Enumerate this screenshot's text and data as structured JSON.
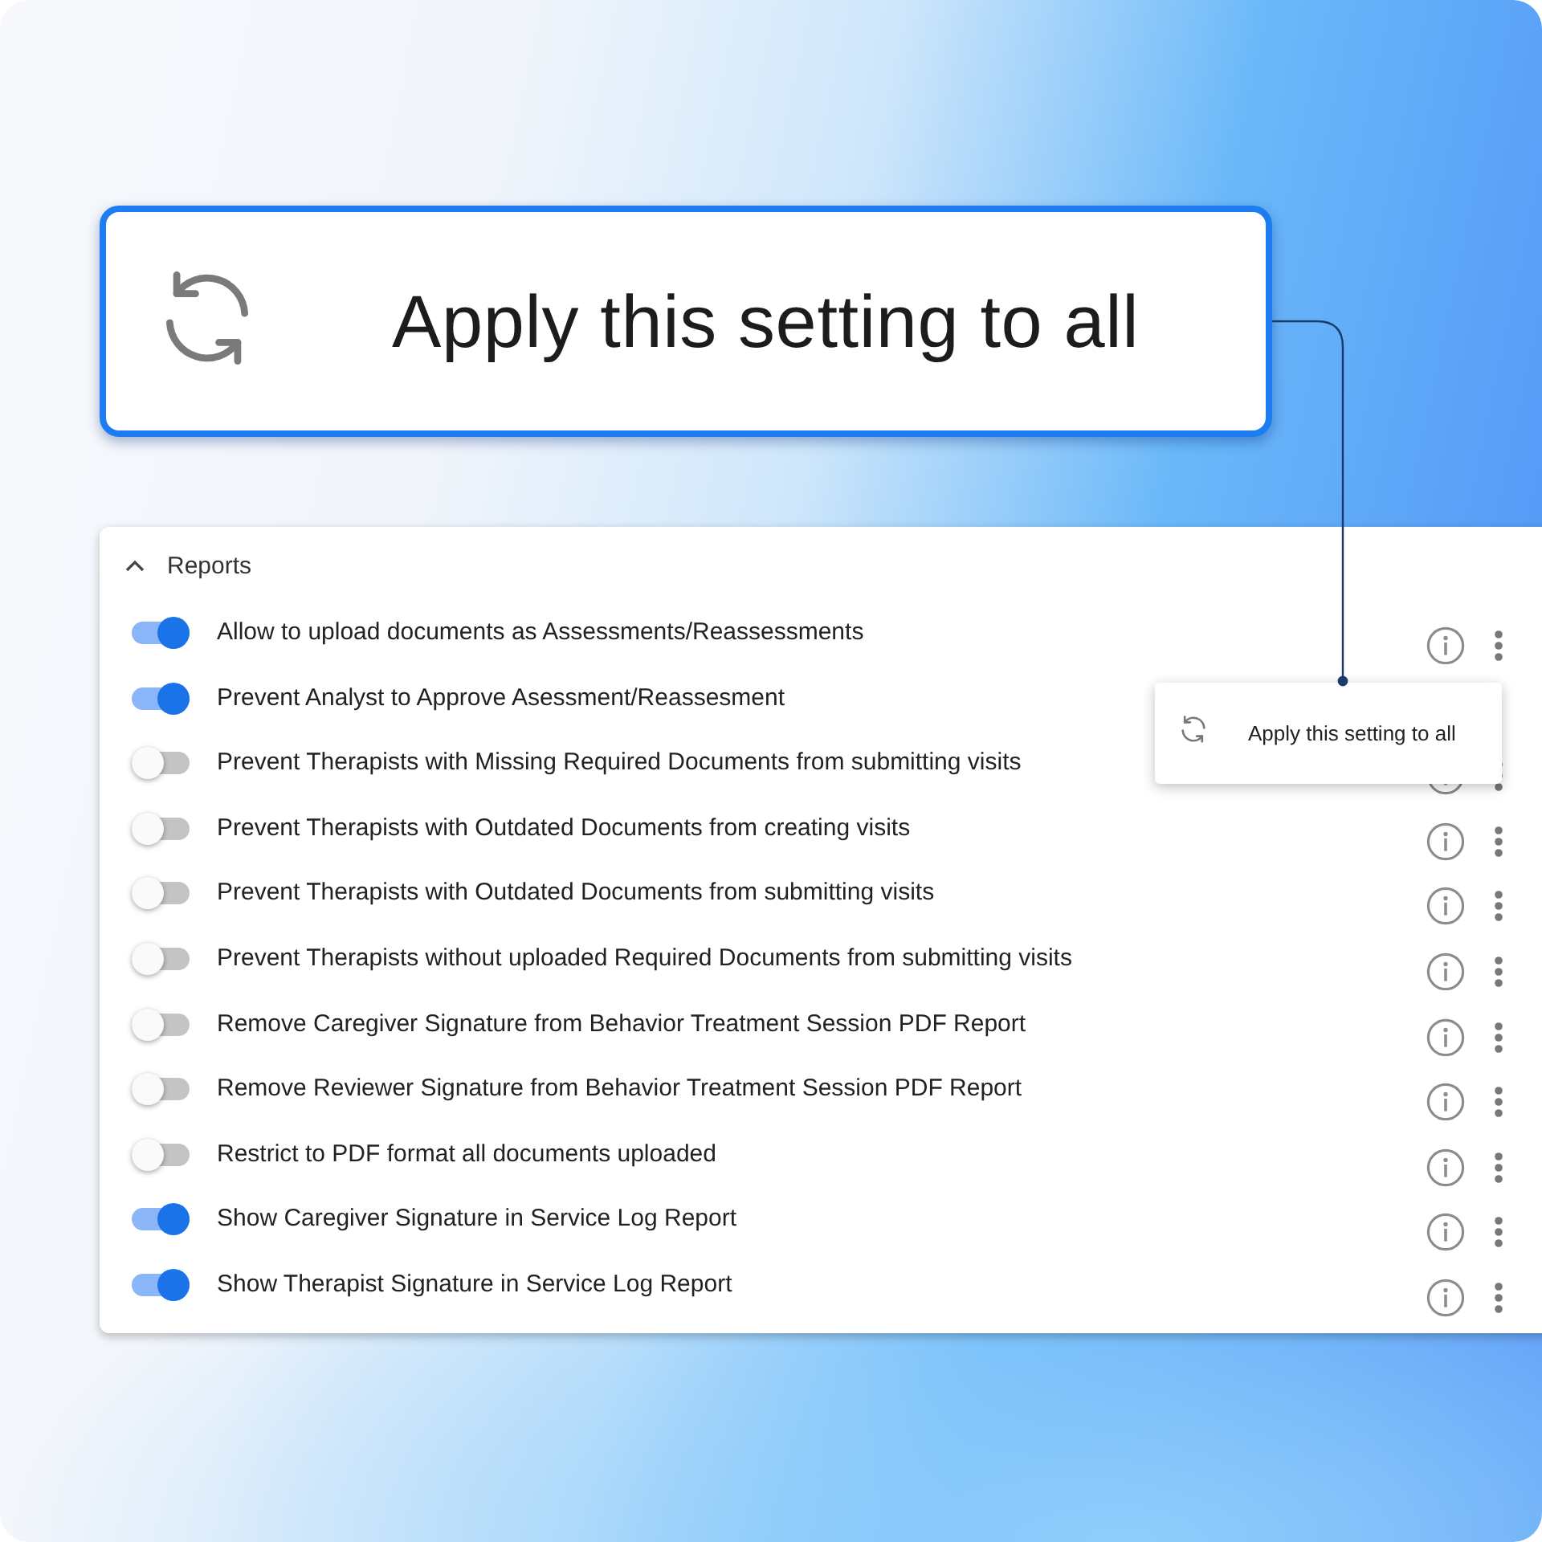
{
  "callout": {
    "label": "Apply this setting to all"
  },
  "panel": {
    "title": "Reports",
    "expanded": true,
    "rows": [
      {
        "label": "Allow to upload documents as Assessments/Reassessments",
        "on": true,
        "actions": true
      },
      {
        "label": "Prevent Analyst to Approve Asessment/Reassesment",
        "on": true,
        "actions": false
      },
      {
        "label": "Prevent Therapists with Missing Required Documents from submitting visits",
        "on": false,
        "actions": true
      },
      {
        "label": "Prevent Therapists with Outdated Documents from creating visits",
        "on": false,
        "actions": true
      },
      {
        "label": "Prevent Therapists with Outdated Documents from submitting visits",
        "on": false,
        "actions": true
      },
      {
        "label": "Prevent Therapists without uploaded Required Documents from submitting visits",
        "on": false,
        "actions": true
      },
      {
        "label": "Remove Caregiver Signature from Behavior Treatment Session PDF Report",
        "on": false,
        "actions": true
      },
      {
        "label": "Remove Reviewer Signature from Behavior Treatment Session PDF Report",
        "on": false,
        "actions": true
      },
      {
        "label": "Restrict to PDF format all documents uploaded",
        "on": false,
        "actions": true
      },
      {
        "label": "Show Caregiver Signature in Service Log Report",
        "on": true,
        "actions": true
      },
      {
        "label": "Show Therapist Signature in Service Log Report",
        "on": true,
        "actions": true
      }
    ]
  },
  "popup": {
    "label": "Apply this setting to all"
  }
}
